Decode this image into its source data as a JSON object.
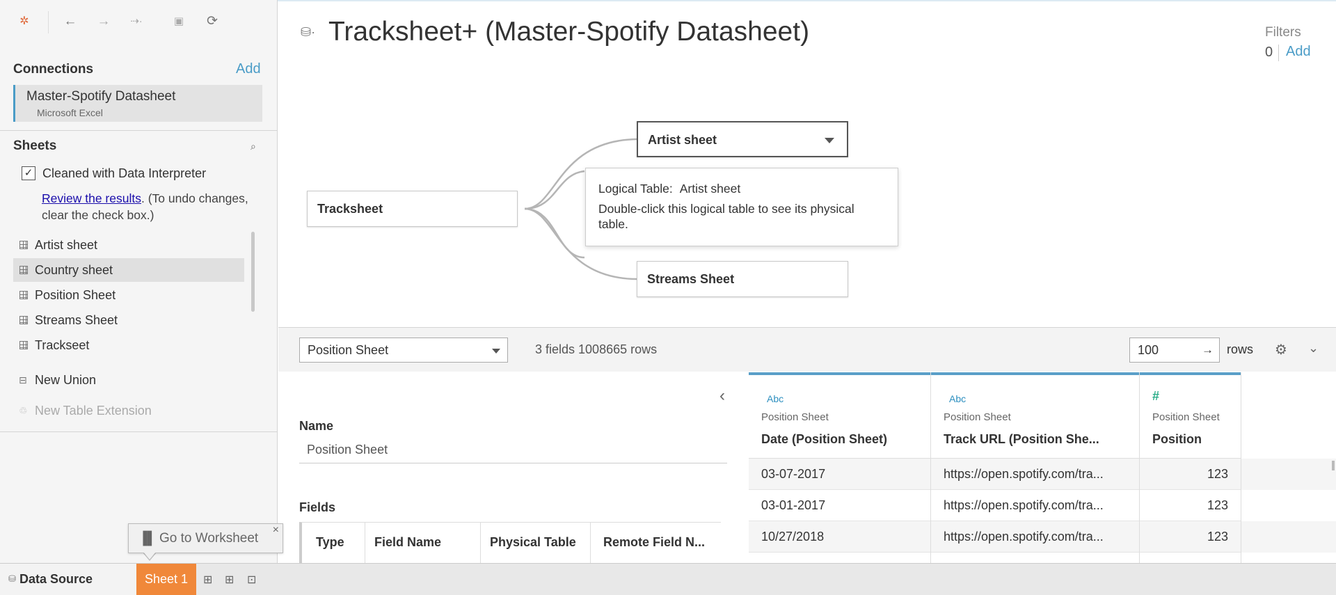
{
  "toolbar": {
    "logo": "tableau-logo-icon",
    "icons": [
      "undo-icon",
      "redo-icon",
      "replay-icon",
      "save-icon",
      "refresh-icon"
    ]
  },
  "connections": {
    "title": "Connections",
    "add_label": "Add",
    "items": [
      {
        "name": "Master-Spotify Datasheet",
        "type": "Microsoft Excel"
      }
    ]
  },
  "sheets": {
    "title": "Sheets",
    "interpreter_label": "Cleaned with Data Interpreter",
    "interpreter_checked": true,
    "review_link": "Review the results",
    "review_text": ". (To undo changes, clear the check box.)",
    "items": [
      {
        "label": "Artist sheet",
        "selected": false
      },
      {
        "label": "Country sheet",
        "selected": true
      },
      {
        "label": "Position Sheet",
        "selected": false
      },
      {
        "label": "Streams Sheet",
        "selected": false
      },
      {
        "label": "Trackseet",
        "selected": false
      }
    ],
    "new_union": "New Union",
    "new_extension": "New Table Extension"
  },
  "canvas": {
    "title": "Tracksheet+ (Master-Spotify Datasheet)",
    "filters_label": "Filters",
    "filters_count": "0",
    "filters_add": "Add",
    "nodes": {
      "root": "Tracksheet",
      "artist": "Artist sheet",
      "streams": "Streams Sheet"
    },
    "tooltip": {
      "label": "Logical Table:",
      "table": "Artist sheet",
      "text": "Double-click this logical table to see its physical table."
    }
  },
  "preview_bar": {
    "selected_table": "Position Sheet",
    "info": "3 fields 1008665 rows",
    "rows_value": "100",
    "rows_label": "rows"
  },
  "meta": {
    "name_label": "Name",
    "name_value": "Position Sheet",
    "fields_label": "Fields",
    "columns": [
      "Type",
      "Field Name",
      "Physical Table",
      "Remote Field N..."
    ]
  },
  "grid": {
    "columns": [
      {
        "type": "Abc",
        "source": "Position Sheet",
        "name": "Date (Position Sheet)"
      },
      {
        "type": "Abc",
        "source": "Position Sheet",
        "name": "Track URL (Position She..."
      },
      {
        "type": "#",
        "source": "Position Sheet",
        "name": "Position"
      }
    ],
    "rows": [
      [
        "03-07-2017",
        "https://open.spotify.com/tra...",
        "123"
      ],
      [
        "03-01-2017",
        "https://open.spotify.com/tra...",
        "123"
      ],
      [
        "10/27/2018",
        "https://open.spotify.com/tra...",
        "123"
      ]
    ]
  },
  "bottom": {
    "data_source_tab": "Data Source",
    "sheet_tab": "Sheet 1",
    "goto_label": "Go to Worksheet",
    "accent_color": "#f0883a"
  }
}
